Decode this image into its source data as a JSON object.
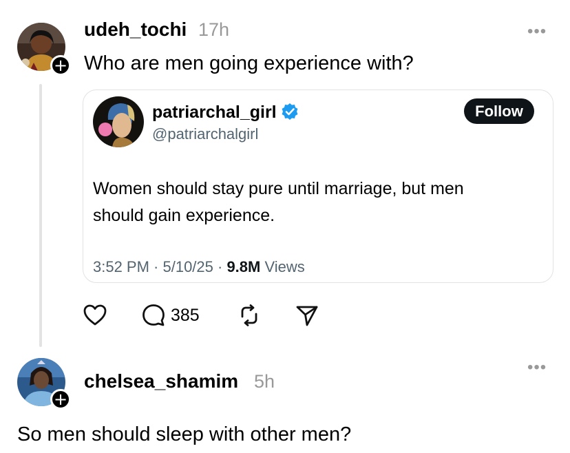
{
  "post1": {
    "username": "udeh_tochi",
    "time": "17h",
    "text": "Who are men going experience with?",
    "more": "•••",
    "follow_plus": "+",
    "quoted": {
      "display_name": "patriarchal_girl",
      "handle": "@patriarchalgirl",
      "follow_label": "Follow",
      "text_line1": "Women should stay pure until marriage, but men",
      "text_line2": "should gain experience.",
      "timestamp": "3:52 PM · 5/10/25 · ",
      "views_count": "9.8M",
      "views_label": " Views"
    },
    "actions": {
      "comments": "385"
    }
  },
  "post2": {
    "username": "chelsea_shamim",
    "time": "5h",
    "text": "So men should sleep with other men?",
    "more": "•••",
    "follow_plus": "+"
  },
  "colors": {
    "verified": "#1d9bf0",
    "follow_bg": "#0f1419",
    "muted": "#999999"
  },
  "icons": [
    "heart-icon",
    "comment-icon",
    "repost-icon",
    "share-icon",
    "verified-icon",
    "more-icon",
    "follow-plus-icon"
  ]
}
